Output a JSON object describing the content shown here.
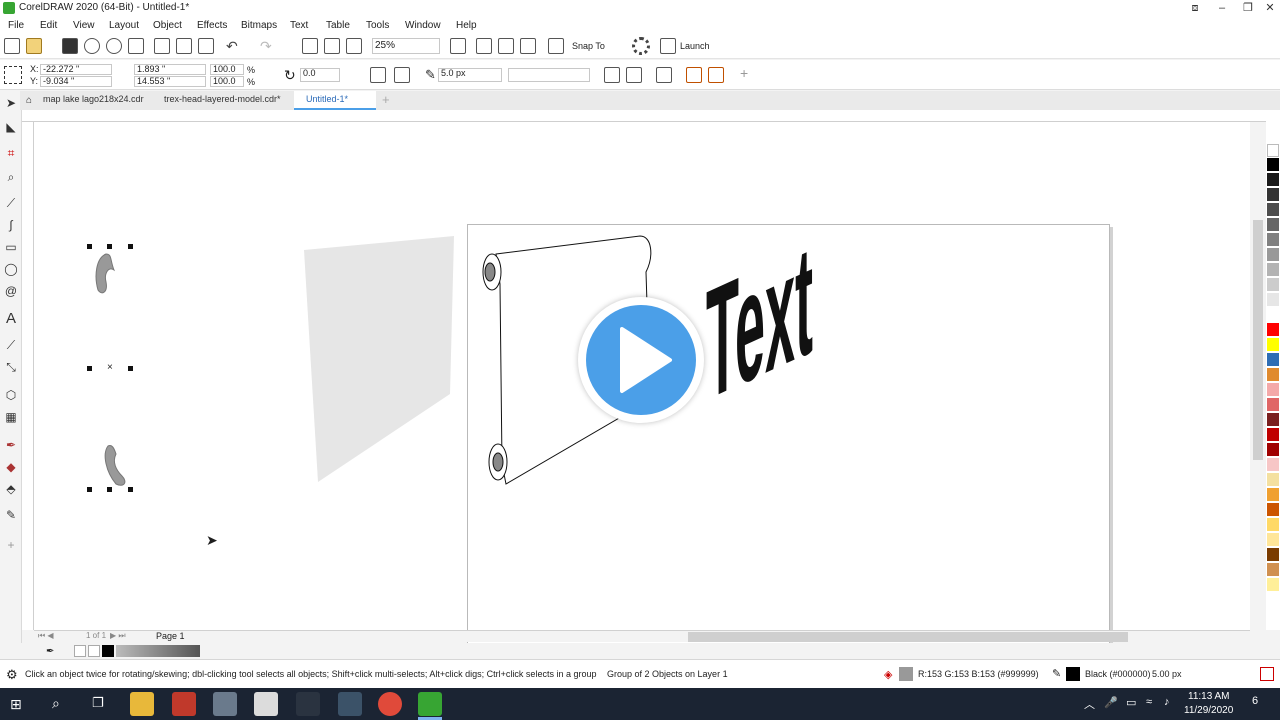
{
  "window": {
    "title": "CorelDRAW 2020 (64-Bit) - Untitled-1*",
    "controls": [
      "⧈",
      "–",
      "❐",
      "✕"
    ]
  },
  "menu": [
    "File",
    "Edit",
    "View",
    "Layout",
    "Object",
    "Effects",
    "Bitmaps",
    "Text",
    "Table",
    "Tools",
    "Window",
    "Help"
  ],
  "toolbar": {
    "zoom": "25%",
    "snap_to": "Snap To",
    "launch": "Launch"
  },
  "propbar": {
    "x": "-22.272 \"",
    "y": "-9.034 \"",
    "w": "1.893 \"",
    "h": "14.553 \"",
    "scale_w": "100.0",
    "scale_h": "100.0",
    "pct": "%",
    "angle": "0.0",
    "outline": "5.0 px",
    "x_label": "X:",
    "y_label": "Y:"
  },
  "tabs": [
    {
      "label": "map lake lago218x24.cdr"
    },
    {
      "label": "trex-head-layered-model.cdr*"
    },
    {
      "label": "Untitled-1*"
    }
  ],
  "canvas": {
    "text_object": "Text"
  },
  "page_nav": {
    "position": "1 of 1",
    "page_label": "Page 1"
  },
  "status": {
    "hint": "Click an object twice for rotating/skewing; dbl-clicking tool selects all objects; Shift+click multi-selects; Alt+click digs; Ctrl+click selects in a group",
    "selection": "Group of 2 Objects on Layer 1",
    "fill_color": "R:153 G:153 B:153 (#999999)",
    "outline_color": "Black (#000000)",
    "outline_width": "5.00 px"
  },
  "taskbar": {
    "time": "11:13 AM",
    "date": "11/29/2020",
    "notifications": "6"
  },
  "colors": {
    "accent": "#4b9fe8",
    "selection_fill": "#999999",
    "app_green": "#37a533"
  },
  "palette": [
    "#ffffff",
    "#000000",
    "#1a1a1a",
    "#333333",
    "#4d4d4d",
    "#666666",
    "#808080",
    "#999999",
    "#b3b3b3",
    "#cccccc",
    "#e6e6e6",
    "#ffffff",
    "#ff0000",
    "#ffff00",
    "#2e6db4",
    "#e08a2e",
    "#f4a9a9",
    "#e06666",
    "#7a1f1f",
    "#c00000",
    "#a00000",
    "#f7c6c6",
    "#f4e0a0",
    "#f0a030",
    "#cc5500",
    "#ffd966",
    "#ffe699",
    "#7a3b00",
    "#d09050",
    "#ffef99"
  ]
}
